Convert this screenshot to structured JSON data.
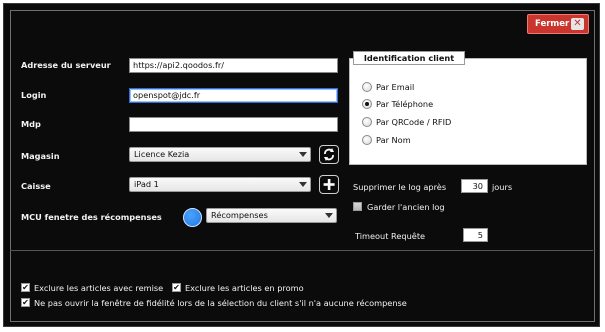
{
  "header": {
    "close_label": "Fermer",
    "close_icon": "close-icon"
  },
  "server": {
    "label": "Adresse du serveur",
    "value": "https://api2.qoodos.fr/"
  },
  "login": {
    "label": "Login",
    "value": "openspot@jdc.fr"
  },
  "password": {
    "label": "Mdp",
    "value": ""
  },
  "store": {
    "label": "Magasin",
    "selected": "Licence Kezia",
    "refresh_icon": "refresh-icon"
  },
  "register": {
    "label": "Caisse",
    "selected": "iPad 1",
    "add_icon": "plus-icon"
  },
  "rewards": {
    "label": "MCU fenetre des récompenses",
    "selected": "Récompenses",
    "color": "#1f78e0"
  },
  "identification": {
    "title": "Identification client",
    "options": [
      {
        "label": "Par Email",
        "selected": false
      },
      {
        "label": "Par Téléphone",
        "selected": true
      },
      {
        "label": "Par QRCode / RFID",
        "selected": false
      },
      {
        "label": "Par Nom",
        "selected": false
      }
    ]
  },
  "log": {
    "delete_label": "Supprimer le log après",
    "days_value": "30",
    "days_unit": "jours",
    "keep_label": "Garder l'ancien log",
    "keep_checked": false
  },
  "timeout": {
    "label": "Timeout Requête",
    "value": "5"
  },
  "options": {
    "exclude_discount": {
      "label": "Exclure les articles avec remise",
      "checked": true
    },
    "exclude_promo": {
      "label": "Exclure les articles en promo",
      "checked": true
    },
    "no_open_window": {
      "label": "Ne pas ouvrir la fenêtre de fidélité lors de la sélection du client s'il n'a aucune récompense",
      "checked": true
    }
  },
  "colors": {
    "background": "#0b0b0b",
    "close_button": "#c9362d",
    "focus": "#2f6fd6"
  }
}
